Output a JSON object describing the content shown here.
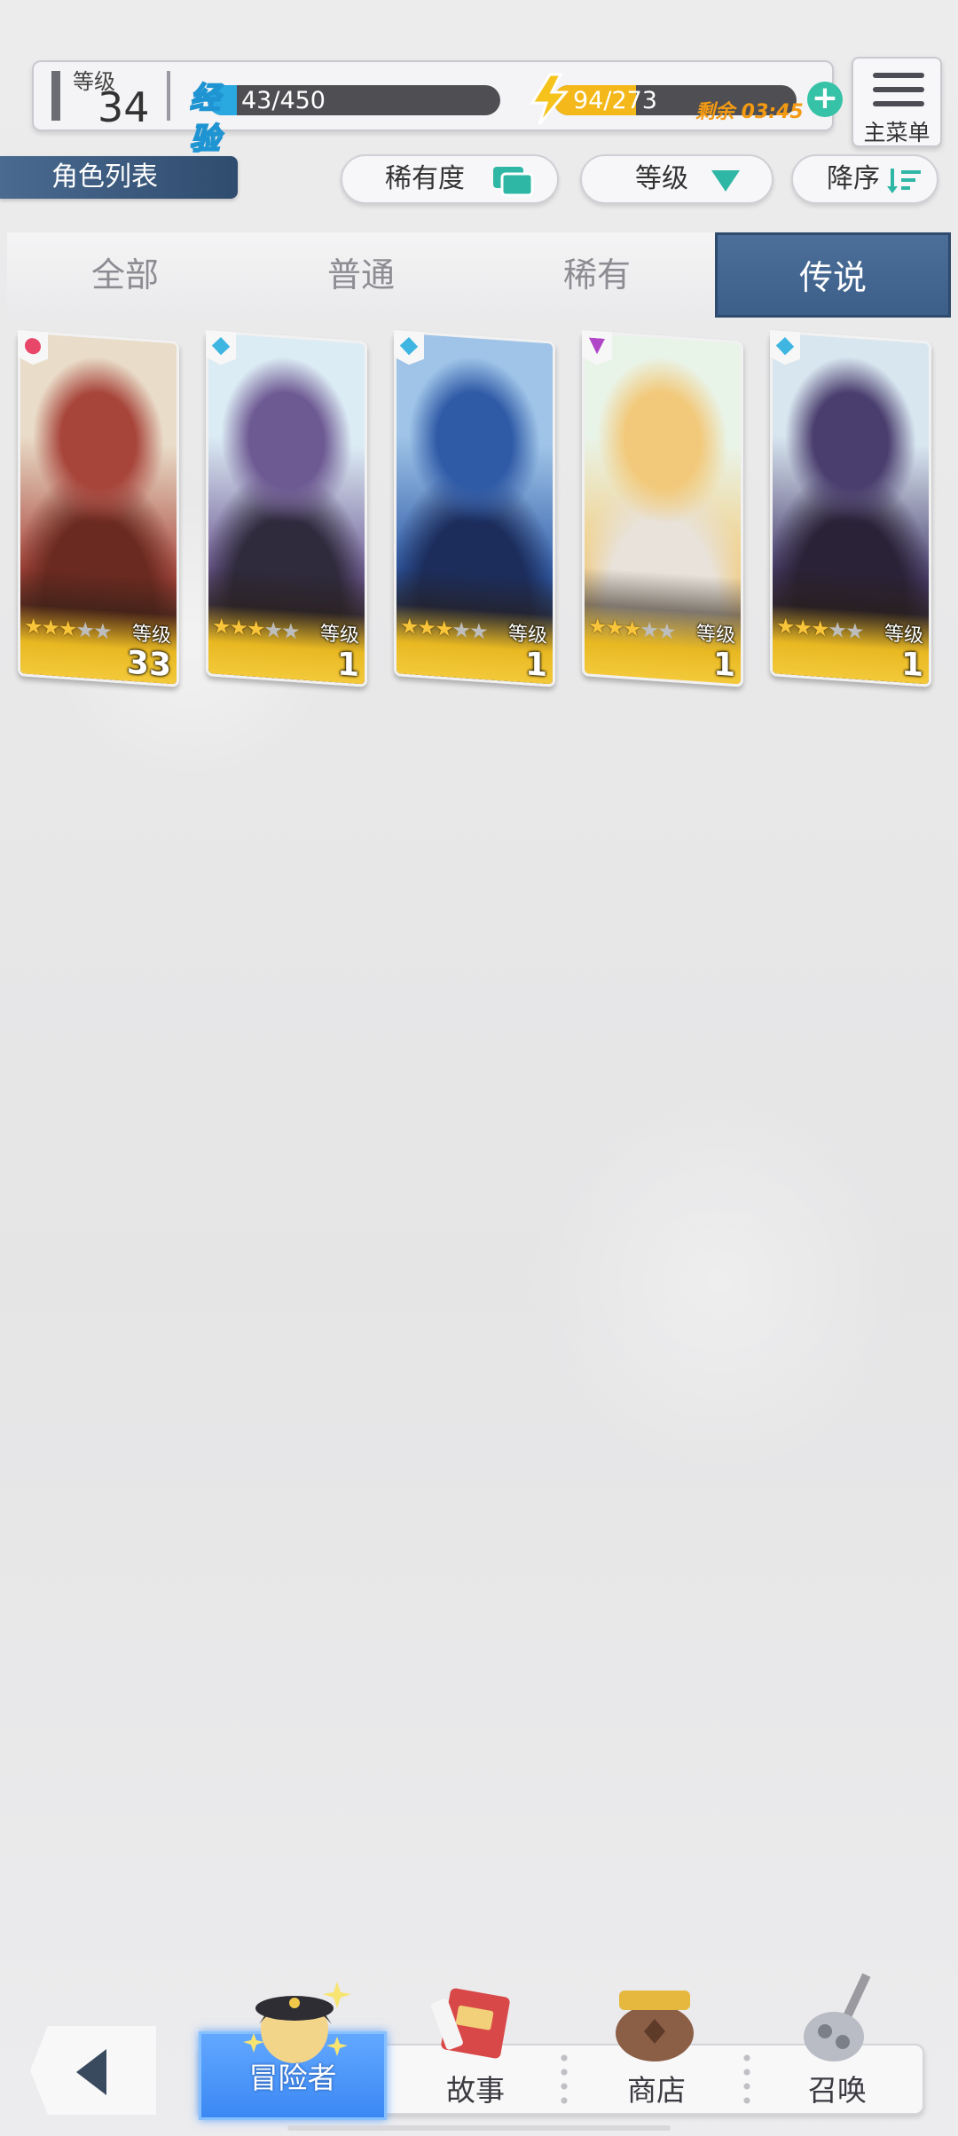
{
  "status": {
    "level_label": "等级",
    "level_value": "34",
    "exp_badge": "经验",
    "exp_text": "43/450",
    "exp_progress": 0.1,
    "stamina_text": "94/273",
    "stamina_progress": 0.34,
    "remaining_text": "剩余 03:45",
    "add_icon": "plus-icon",
    "menu_label": "主菜单"
  },
  "toolbar": {
    "title": "角色列表",
    "rarity_label": "稀有度",
    "level_label": "等级",
    "order_label": "降序"
  },
  "tabs": [
    {
      "label": "全部",
      "active": false
    },
    {
      "label": "普通",
      "active": false
    },
    {
      "label": "稀有",
      "active": false
    },
    {
      "label": "传说",
      "active": true
    }
  ],
  "cards": [
    {
      "element": "fire",
      "element_color": "#e8476a",
      "stars": 3,
      "level_label": "等级",
      "level": "33",
      "art_colors": [
        "#e9dcc8",
        "#a8453b",
        "#6b2a21"
      ]
    },
    {
      "element": "wind",
      "element_color": "#3fb6e2",
      "stars": 3,
      "level_label": "等级",
      "level": "1",
      "art_colors": [
        "#dcecf5",
        "#6e5a93",
        "#2f2a3c"
      ]
    },
    {
      "element": "wind",
      "element_color": "#3fb6e2",
      "stars": 3,
      "level_label": "等级",
      "level": "1",
      "art_colors": [
        "#9fc4e8",
        "#2f5aa6",
        "#1c2d5c"
      ]
    },
    {
      "element": "dark",
      "element_color": "#b045c8",
      "stars": 3,
      "level_label": "等级",
      "level": "1",
      "art_colors": [
        "#e9f4e9",
        "#f2c97a",
        "#e8e2da"
      ]
    },
    {
      "element": "wind",
      "element_color": "#3fb6e2",
      "stars": 3,
      "level_label": "等级",
      "level": "1",
      "art_colors": [
        "#d8e6f0",
        "#4a3e6e",
        "#2a2236"
      ]
    }
  ],
  "nav": {
    "back_icon": "back-arrow-icon",
    "items": [
      {
        "label": "冒险者",
        "icon": "adventurer-icon",
        "active": true
      },
      {
        "label": "故事",
        "icon": "book-icon",
        "active": false
      },
      {
        "label": "商店",
        "icon": "shop-bag-icon",
        "active": false
      },
      {
        "label": "召唤",
        "icon": "summon-icon",
        "active": false
      }
    ]
  },
  "colors": {
    "accent_blue": "#3c5f89",
    "exp_blue": "#2aa9e0",
    "stamina_yellow": "#f4b81b",
    "teal": "#2fb7a5"
  }
}
